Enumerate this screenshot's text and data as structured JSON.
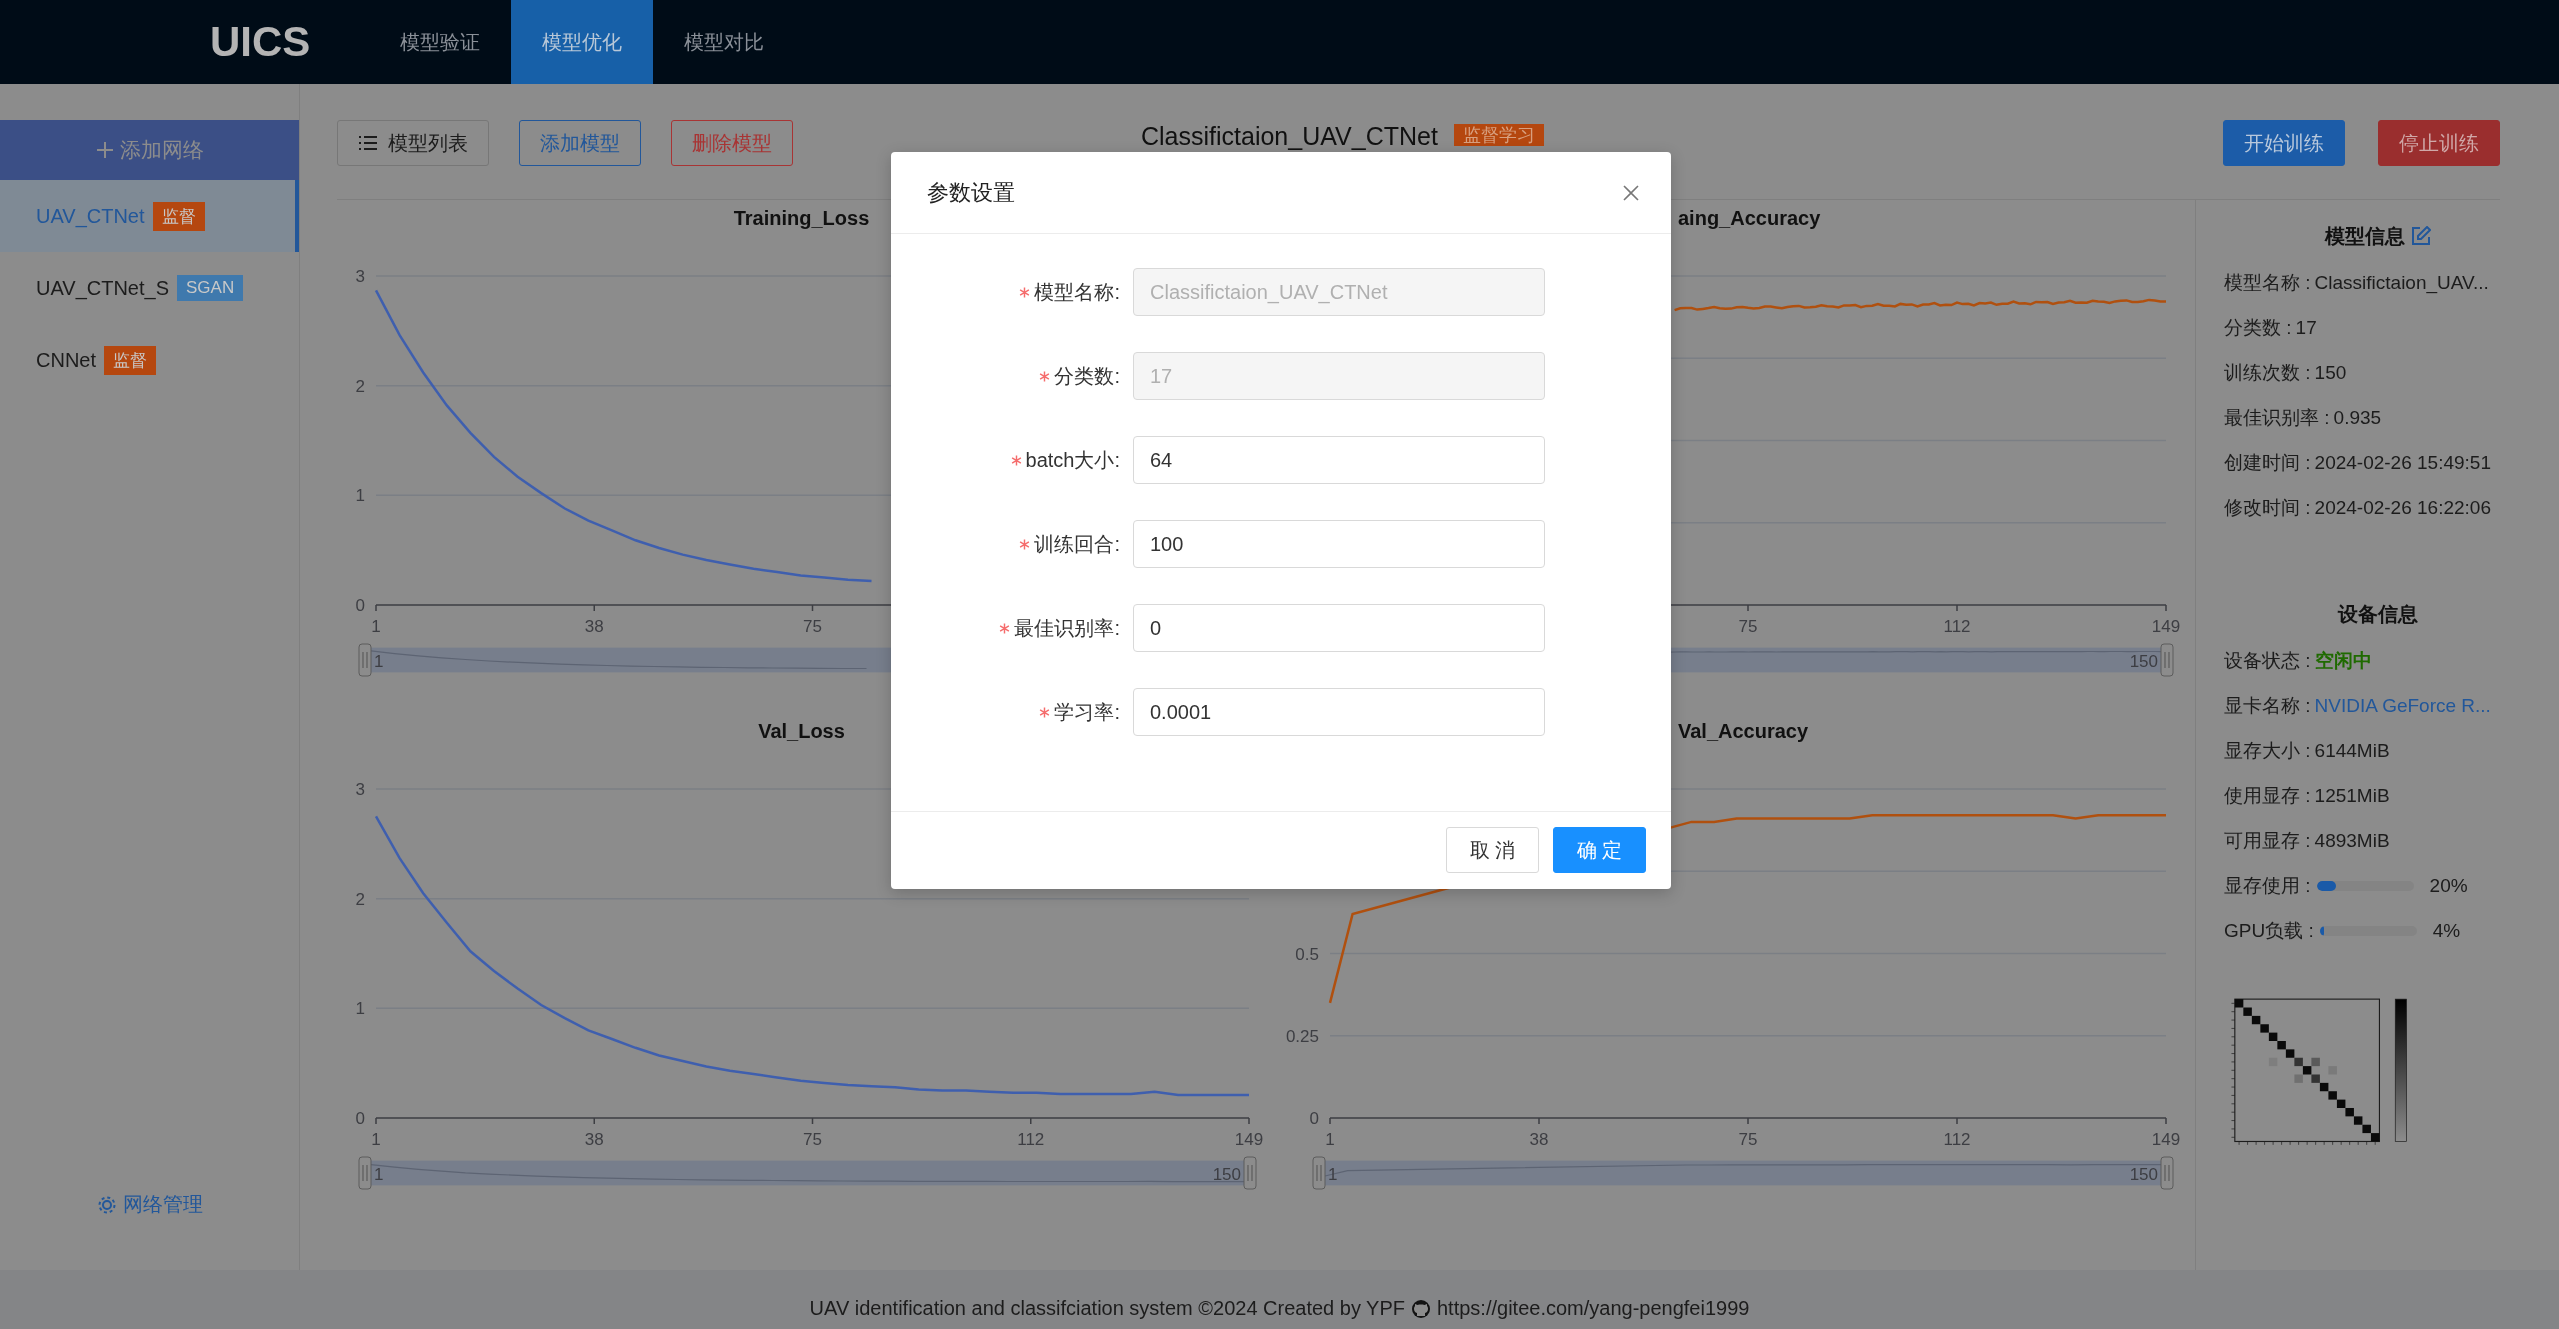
{
  "nav": {
    "logo": "UICS",
    "tabs": [
      {
        "label": "模型验证",
        "selected": false
      },
      {
        "label": "模型优化",
        "selected": true
      },
      {
        "label": "模型对比",
        "selected": false
      }
    ]
  },
  "sidebar": {
    "add_button": "添加网络",
    "networks": [
      {
        "name": "UAV_CTNet",
        "tag": "监督",
        "color": "#b5470f",
        "selected": true
      },
      {
        "name": "UAV_CTNet_S",
        "tag": "SGAN",
        "color": "#3f79ad",
        "selected": false
      },
      {
        "name": "CNNet",
        "tag": "监督",
        "color": "#b5470f",
        "selected": false
      }
    ],
    "manage_link": "网络管理"
  },
  "toolbar": {
    "buttons": [
      {
        "label": "模型列表",
        "kind": "default"
      },
      {
        "label": "添加模型",
        "kind": "outline-primary"
      },
      {
        "label": "删除模型",
        "kind": "outline-danger"
      }
    ],
    "model_title": "Classifictaion_UAV_CTNet",
    "model_tag": "监督学习",
    "actions": [
      {
        "label": "开始训练",
        "kind": "primary"
      },
      {
        "label": "停止训练",
        "kind": "danger"
      }
    ]
  },
  "charts": [
    {
      "chart_data": {
        "type": "line",
        "title": "Training_Loss",
        "x": [
          1,
          5,
          9,
          13,
          17,
          21,
          25,
          29,
          33,
          37,
          41,
          45,
          49,
          53,
          57,
          61,
          65,
          69,
          73,
          77,
          81,
          85
        ],
        "xlim": [
          1,
          149
        ],
        "ylim": [
          0,
          3
        ],
        "xticks": [
          1,
          38,
          75
        ],
        "yticks": [
          0,
          1,
          2,
          3
        ],
        "series": [
          {
            "color": "#3f5fae",
            "values": [
              2.87,
              2.46,
              2.12,
              1.82,
              1.57,
              1.35,
              1.17,
              1.02,
              0.88,
              0.77,
              0.68,
              0.59,
              0.52,
              0.46,
              0.41,
              0.37,
              0.33,
              0.3,
              0.27,
              0.25,
              0.23,
              0.22
            ]
          }
        ]
      },
      "slider": {
        "level": 1,
        "start_label": "1"
      }
    },
    {
      "title": "aing_Accuracy",
      "x_labels": [
        "75",
        "112",
        "149"
      ],
      "slider": {
        "level": 1,
        "end_label": "150"
      }
    },
    {
      "chart_data": {
        "type": "line",
        "title": "Val_Loss",
        "x": [
          1,
          5,
          9,
          13,
          17,
          21,
          25,
          29,
          33,
          37,
          41,
          45,
          49,
          53,
          57,
          61,
          65,
          69,
          73,
          77,
          81,
          85,
          89,
          93,
          97,
          101,
          105,
          109,
          113,
          117,
          121,
          125,
          129,
          133,
          137,
          141,
          145,
          149
        ],
        "xlim": [
          1,
          149
        ],
        "ylim": [
          0,
          3
        ],
        "xticks": [
          1,
          38,
          75,
          112,
          149
        ],
        "yticks": [
          0,
          1,
          2,
          3
        ],
        "series": [
          {
            "color": "#3f5fae",
            "values": [
              2.75,
              2.37,
              2.05,
              1.78,
              1.52,
              1.34,
              1.18,
              1.03,
              0.91,
              0.8,
              0.72,
              0.64,
              0.57,
              0.52,
              0.47,
              0.43,
              0.4,
              0.37,
              0.34,
              0.32,
              0.3,
              0.29,
              0.28,
              0.26,
              0.25,
              0.25,
              0.24,
              0.23,
              0.23,
              0.22,
              0.22,
              0.22,
              0.22,
              0.24,
              0.21,
              0.21,
              0.21,
              0.21
            ]
          }
        ]
      },
      "slider": {
        "level": 1,
        "start_label": "1",
        "end_label": "150"
      }
    },
    {
      "chart_data": {
        "type": "line",
        "title": "Val_Accuracy",
        "x": [
          1,
          5,
          65,
          69,
          73,
          77,
          81,
          85,
          89,
          93,
          97,
          101,
          105,
          109,
          113,
          117,
          121,
          125,
          129,
          133,
          137,
          141,
          145,
          149
        ],
        "xlim": [
          1,
          149
        ],
        "ylim": [
          0,
          1
        ],
        "xticks": [
          1,
          38,
          75,
          112,
          149
        ],
        "yticks": [
          0,
          0.25,
          0.5
        ],
        "series": [
          {
            "color": "#b0500f",
            "values": [
              0.35,
              0.62,
              0.9,
              0.9,
              0.91,
              0.91,
              0.91,
              0.91,
              0.91,
              0.91,
              0.92,
              0.92,
              0.92,
              0.92,
              0.92,
              0.92,
              0.92,
              0.92,
              0.92,
              0.91,
              0.92,
              0.92,
              0.92,
              0.92
            ]
          }
        ]
      },
      "slider": {
        "level": 1,
        "start_label": "1",
        "end_label": "150"
      }
    }
  ],
  "info": {
    "model": {
      "title": "模型信息",
      "rows": [
        {
          "label": "模型名称 :",
          "value": "Classifictaion_UAV...",
          "kind": "text"
        },
        {
          "label": "分类数 :",
          "value": "17",
          "kind": "text"
        },
        {
          "label": "训练次数 :",
          "value": "150",
          "kind": "text"
        },
        {
          "label": "最佳识别率 :",
          "value": "0.935",
          "kind": "text"
        },
        {
          "label": "创建时间 :",
          "value": "2024-02-26 15:49:51",
          "kind": "text"
        },
        {
          "label": "修改时间 :",
          "value": "2024-02-26 16:22:06",
          "kind": "text"
        }
      ]
    },
    "device": {
      "title": "设备信息",
      "rows": [
        {
          "label": "设备状态 :",
          "value": "空闲中",
          "kind": "status"
        },
        {
          "label": "显卡名称 :",
          "value": "NVIDIA GeForce R...",
          "kind": "link"
        },
        {
          "label": "显存大小 :",
          "value": "6144MiB",
          "kind": "text"
        },
        {
          "label": "使用显存 :",
          "value": "1251MiB",
          "kind": "text"
        },
        {
          "label": "可用显存 :",
          "value": "4893MiB",
          "kind": "text"
        },
        {
          "label": "显存使用 :",
          "kind": "meter",
          "level": 0.2,
          "reading": "20%"
        },
        {
          "label": "GPU负载 :",
          "kind": "meter",
          "level": 0.04,
          "reading": "4%"
        }
      ]
    }
  },
  "footer": {
    "text": "UAV identification and classifciation system ©2024 Created by YPF",
    "link": "https://gitee.com/yang-pengfei1999"
  },
  "dialog": {
    "title": "参数设置",
    "fields": [
      {
        "label": "模型名称:",
        "required": true,
        "value": "Classifictaion_UAV_CTNet",
        "disabled": true
      },
      {
        "label": "分类数:",
        "required": true,
        "value": "17",
        "disabled": true
      },
      {
        "label": "batch大小:",
        "required": true,
        "value": "64",
        "disabled": false
      },
      {
        "label": "训练回合:",
        "required": true,
        "value": "100",
        "disabled": false
      },
      {
        "label": "最佳识别率:",
        "required": true,
        "value": "0",
        "disabled": false
      },
      {
        "label": "学习率:",
        "required": true,
        "value": "0.0001",
        "disabled": false
      }
    ],
    "buttons": [
      {
        "label": "取 消",
        "kind": "default"
      },
      {
        "label": "确 定",
        "kind": "primary"
      }
    ]
  }
}
